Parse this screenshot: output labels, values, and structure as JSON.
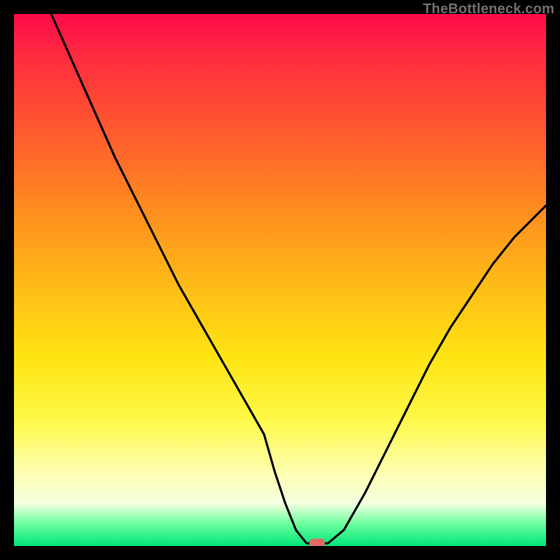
{
  "watermark": {
    "text": "TheBottleneck.com"
  },
  "chart_data": {
    "type": "line",
    "title": "",
    "xlabel": "",
    "ylabel": "",
    "xlim": [
      0,
      100
    ],
    "ylim": [
      0,
      100
    ],
    "grid": false,
    "legend": false,
    "series": [
      {
        "name": "bottleneck-curve",
        "x": [
          7,
          11,
          15,
          19,
          23,
          27,
          31,
          35,
          39,
          43,
          47,
          49,
          51,
          53,
          55,
          57,
          59,
          62,
          66,
          70,
          74,
          78,
          82,
          86,
          90,
          94,
          98,
          100
        ],
        "values": [
          100,
          91,
          82,
          73,
          65,
          57,
          49,
          42,
          35,
          28,
          21,
          14,
          8,
          3,
          0.5,
          0.5,
          0.5,
          3,
          10,
          18,
          26,
          34,
          41,
          47,
          53,
          58,
          62,
          64
        ]
      }
    ],
    "marker": {
      "x": 57,
      "y": 0.5,
      "color": "#e26b63"
    },
    "background_gradient": {
      "stops": [
        {
          "pos": 0,
          "color": "#ff0a4a"
        },
        {
          "pos": 0.5,
          "color": "#ffb817"
        },
        {
          "pos": 0.86,
          "color": "#fdffae"
        },
        {
          "pos": 1,
          "color": "#00e57a"
        }
      ]
    }
  }
}
